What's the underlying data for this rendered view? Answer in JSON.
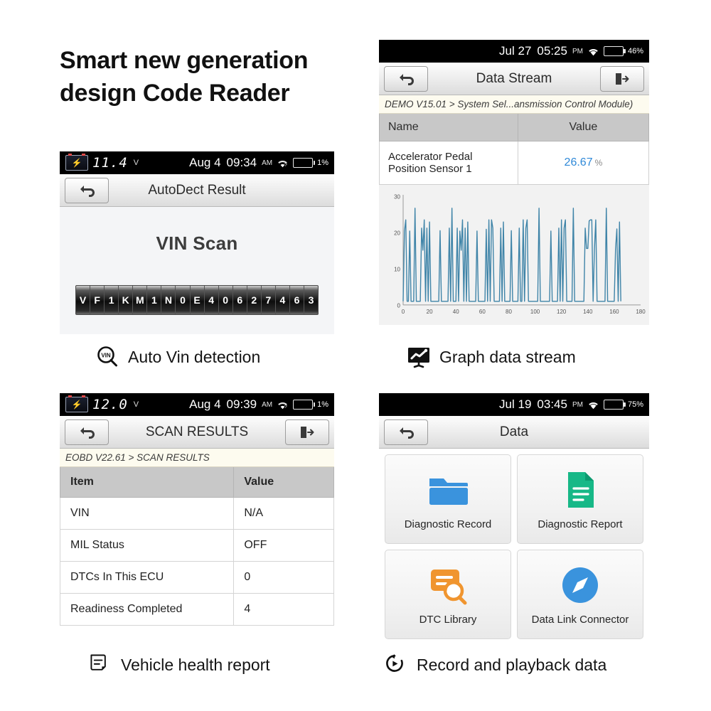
{
  "headline": "Smart new generation design Code Reader",
  "panels": {
    "vin": {
      "status": {
        "voltage": "11.4",
        "voltage_unit": "V",
        "date": "Aug 4",
        "time": "09:34",
        "ampm": "AM",
        "battery_pct": "1%",
        "battery_level": 12
      },
      "title": "AutoDect Result",
      "screen_title": "VIN Scan",
      "vin_chars": [
        "V",
        "F",
        "1",
        "K",
        "M",
        "1",
        "N",
        "0",
        "E",
        "4",
        "0",
        "6",
        "2",
        "7",
        "4",
        "6",
        "3"
      ],
      "caption": "Auto Vin detection",
      "caption_icon": "vin-magnifier-icon"
    },
    "stream": {
      "status": {
        "date": "Jul 27",
        "time": "05:25",
        "ampm": "PM",
        "battery_pct": "46%",
        "battery_level": 46
      },
      "title": "Data Stream",
      "breadcrumb": "DEMO V15.01 > System Sel...ansmission Control Module)",
      "columns": [
        "Name",
        "Value"
      ],
      "rows": [
        {
          "name": "Accelerator Pedal Position Sensor 1",
          "value": "26.67",
          "unit": "%"
        }
      ],
      "caption": "Graph data stream",
      "caption_icon": "chart-monitor-icon"
    },
    "scan": {
      "status": {
        "voltage": "12.0",
        "voltage_unit": "V",
        "date": "Aug 4",
        "time": "09:39",
        "ampm": "AM",
        "battery_pct": "1%",
        "battery_level": 12
      },
      "title": "SCAN RESULTS",
      "breadcrumb": "EOBD V22.61 > SCAN RESULTS",
      "columns": [
        "Item",
        "Value"
      ],
      "rows": [
        {
          "item": "VIN",
          "value": "N/A"
        },
        {
          "item": "MIL Status",
          "value": "OFF"
        },
        {
          "item": "DTCs In This ECU",
          "value": "0"
        },
        {
          "item": "Readiness Completed",
          "value": "4"
        }
      ],
      "caption": "Vehicle health report",
      "caption_icon": "report-document-icon"
    },
    "data": {
      "status": {
        "date": "Jul 19",
        "time": "03:45",
        "ampm": "PM",
        "battery_pct": "75%",
        "battery_level": 75
      },
      "title": "Data",
      "tiles": [
        {
          "label": "Diagnostic Record",
          "icon": "folder-icon",
          "color": "#3a93dd"
        },
        {
          "label": "Diagnostic Report",
          "icon": "document-lines-icon",
          "color": "#17b887"
        },
        {
          "label": "DTC Library",
          "icon": "library-search-icon",
          "color": "#f0952f"
        },
        {
          "label": "Data Link Connector",
          "icon": "compass-icon",
          "color": "#3a93dd"
        }
      ],
      "caption": "Record and playback data",
      "caption_icon": "replay-icon"
    }
  },
  "colors": {
    "chart_line": "#3f84a8",
    "chart_bg": "#f2f2f2",
    "value_blue": "#2f89d8",
    "battery_green": "#27d043",
    "header_gray": "#c8c8c8"
  },
  "chart_data": {
    "type": "line",
    "title": "",
    "xlabel": "",
    "ylabel": "",
    "xlim": [
      0,
      180
    ],
    "ylim": [
      0,
      30
    ],
    "xticks": [
      0,
      20,
      40,
      60,
      80,
      100,
      120,
      140,
      160,
      180
    ],
    "yticks": [
      0,
      10,
      20,
      30
    ],
    "grid": false,
    "legend": "none",
    "series": [
      {
        "name": "Accelerator Pedal Position Sensor 1",
        "color": "#3f84a8",
        "x": [
          0,
          1,
          2,
          3,
          4,
          5,
          6,
          7,
          8,
          9,
          10,
          11,
          12,
          13,
          14,
          15,
          16,
          17,
          18,
          19,
          20,
          21,
          22,
          23,
          24,
          25,
          26,
          27,
          28,
          29,
          30,
          31,
          32,
          33,
          34,
          35,
          36,
          37,
          38,
          39,
          40,
          41,
          42,
          43,
          44,
          45,
          46,
          47,
          48,
          49,
          50,
          51,
          52,
          53,
          54,
          55,
          56,
          57,
          58,
          59,
          60,
          61,
          62,
          63,
          64,
          65,
          66,
          67,
          68,
          69,
          70,
          71,
          72,
          73,
          74,
          75,
          76,
          77,
          78,
          79,
          80,
          81,
          82,
          83,
          84,
          85,
          86,
          87,
          88,
          89,
          90,
          91,
          92,
          93,
          94,
          95,
          96,
          97,
          98,
          99,
          100,
          101,
          102,
          103,
          104,
          105,
          106,
          107,
          108,
          109,
          110,
          111,
          112,
          113,
          114,
          115,
          116,
          117,
          118,
          119,
          120,
          121,
          122,
          123,
          124,
          125,
          126,
          127,
          128,
          129,
          130,
          131,
          132,
          133,
          134,
          135,
          136,
          137,
          138,
          139,
          140,
          141,
          142,
          143,
          144,
          145,
          146,
          147,
          148,
          149,
          150,
          151,
          152,
          153,
          154,
          155,
          156,
          157,
          158,
          159,
          160,
          161,
          162,
          163,
          164,
          165,
          166,
          167,
          168,
          169,
          170
        ],
        "y": [
          1,
          20.4,
          23.5,
          1,
          1,
          20.4,
          1,
          1,
          1,
          26.7,
          1,
          1,
          1,
          1,
          21.2,
          15.1,
          23.5,
          1,
          21.2,
          1,
          22.9,
          1,
          1,
          1,
          1,
          1,
          1,
          1,
          20.5,
          1,
          1,
          1,
          1,
          1,
          1,
          21.2,
          1,
          26.7,
          1,
          1,
          1,
          21.2,
          1,
          20.4,
          15.1,
          23.5,
          1,
          21.2,
          1,
          22.9,
          1,
          1,
          1,
          1,
          1,
          1,
          20.4,
          1,
          1,
          1,
          1,
          1,
          1,
          20.9,
          1,
          23.5,
          1,
          23.5,
          21.2,
          1,
          1,
          1,
          1,
          1,
          21.2,
          1,
          22.9,
          1,
          1,
          1,
          1,
          1,
          20.5,
          1,
          1,
          1,
          1,
          1,
          21.2,
          1,
          1,
          23.5,
          1,
          21.2,
          23.5,
          1,
          1,
          1,
          1,
          1,
          1,
          1,
          1,
          26.7,
          1,
          1,
          1,
          1,
          1,
          1,
          1,
          1,
          20.4,
          1,
          1,
          1,
          1,
          1,
          21.2,
          1,
          23.5,
          1,
          21.2,
          23.5,
          1,
          1,
          1,
          1,
          1,
          26.7,
          1,
          1,
          1,
          1,
          1,
          1,
          1,
          1,
          21.2,
          15.6,
          15.6,
          23.2,
          23.5,
          23.5,
          1,
          15.4,
          23.5,
          1,
          1,
          1,
          1,
          1,
          1,
          1,
          26.7,
          1,
          1,
          1,
          1,
          1,
          1,
          15.4,
          21.0,
          1,
          22.9,
          1
        ]
      }
    ]
  }
}
